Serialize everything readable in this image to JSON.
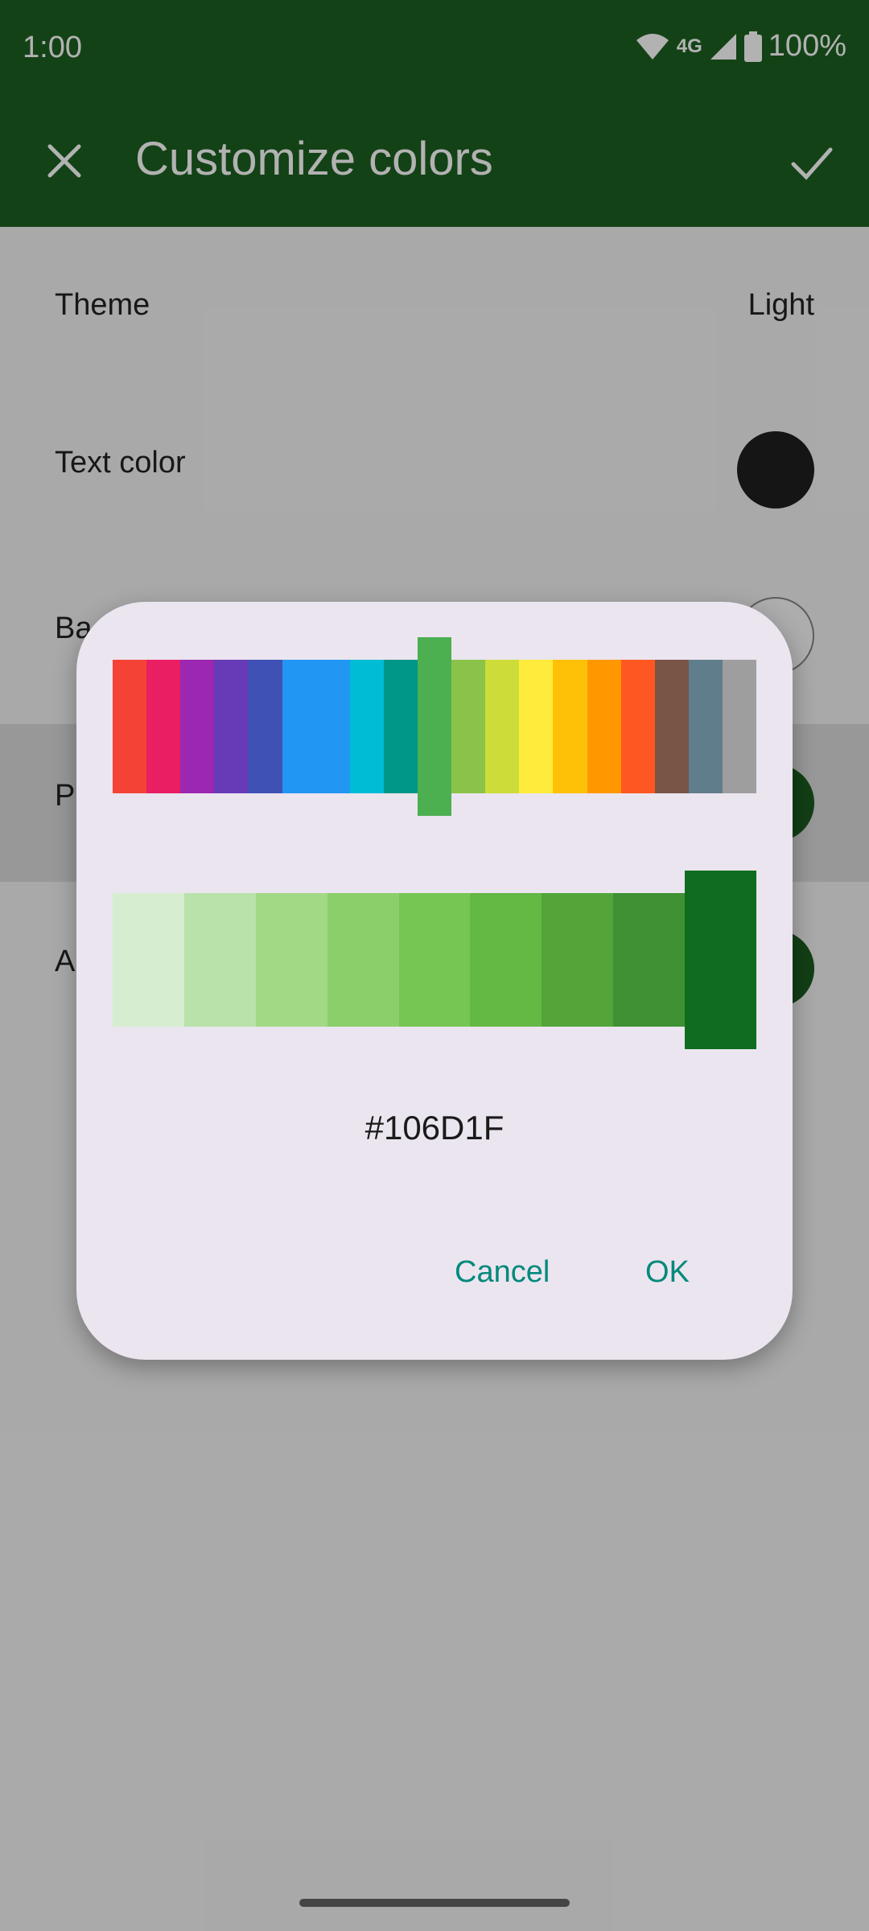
{
  "status": {
    "time": "1:00",
    "network": "4G",
    "battery": "100%"
  },
  "appbar": {
    "title": "Customize colors"
  },
  "settings": [
    {
      "label": "Theme",
      "value": "Light"
    },
    {
      "label": "Text color",
      "color": "#1f1f1f"
    },
    {
      "label": "Ba",
      "color": "#ffffff"
    },
    {
      "label": "Pr",
      "color": "#1b5e20"
    },
    {
      "label": "A",
      "color": "#1b5e20"
    }
  ],
  "dialog": {
    "palette": [
      "#f44336",
      "#e91e63",
      "#9c27b0",
      "#673ab7",
      "#3f51b5",
      "#2196f3",
      "#2196f3",
      "#00bcd4",
      "#009688",
      "#4caf50",
      "#8bc34a",
      "#cddc39",
      "#ffeb3b",
      "#ffc107",
      "#ff9800",
      "#ff5722",
      "#795548",
      "#607d8b",
      "#9e9e9e"
    ],
    "selected_palette_index": 9,
    "shades": [
      "#d6eecf",
      "#b9e2aa",
      "#a1d985",
      "#8bcf6b",
      "#76c653",
      "#64b844",
      "#53a53a",
      "#3f9133",
      "#106d1f"
    ],
    "selected_shade_index": 8,
    "hex_value": "#106D1F",
    "cancel_label": "Cancel",
    "ok_label": "OK"
  }
}
